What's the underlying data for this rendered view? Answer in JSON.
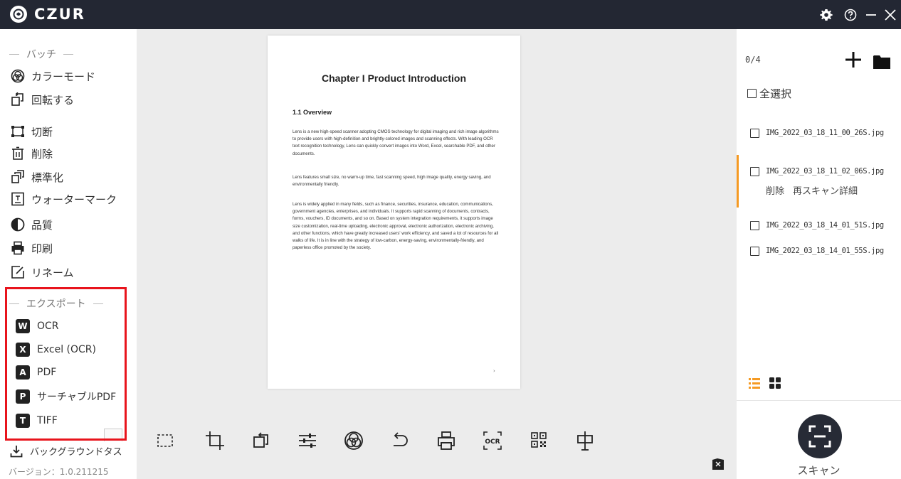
{
  "app": {
    "brand": "CZUR"
  },
  "sidebar": {
    "batch_header": "バッチ",
    "items": [
      {
        "label": "カラーモード",
        "icon": "color-mode-icon"
      },
      {
        "label": "回転する",
        "icon": "rotate-icon"
      },
      {
        "label": "切断",
        "icon": "crop-icon"
      },
      {
        "label": "削除",
        "icon": "trash-icon"
      },
      {
        "label": "標準化",
        "icon": "normalize-icon"
      },
      {
        "label": "ウォーターマーク",
        "icon": "watermark-icon"
      },
      {
        "label": "品質",
        "icon": "quality-icon"
      },
      {
        "label": "印刷",
        "icon": "print-icon"
      },
      {
        "label": "リネーム",
        "icon": "rename-icon"
      }
    ],
    "export_header": "エクスポート",
    "export_items": [
      {
        "label": "OCR",
        "badge": "W",
        "icon": "word-icon"
      },
      {
        "label": "Excel (OCR)",
        "badge": "X",
        "icon": "excel-icon"
      },
      {
        "label": "PDF",
        "badge": "A",
        "icon": "pdf-icon"
      },
      {
        "label": "サーチャブルPDF",
        "badge": "P",
        "icon": "searchable-pdf-icon"
      },
      {
        "label": "TIFF",
        "badge": "T",
        "icon": "tiff-icon"
      }
    ],
    "background_task": "バックグラウンドタス",
    "version": "バージョン：1.0.211215"
  },
  "document": {
    "title": "Chapter I Product Introduction",
    "section": "1.1 Overview",
    "paragraphs": [
      "Lens is a new high-speed scanner adopting CMOS technology for digital imaging and rich image algorithms to provide users with high-definition and brightly-colored images and scanning effects. With leading OCR text recognition technology, Lens can quickly convert images into Word, Excel, searchable PDF, and other documents.",
      "Lens features small size, no warm-up time, fast scanning speed, high image quality, energy saving, and environmentally friendly.",
      "Lens is widely applied in many fields, such as finance, securities, insurance, education, communications, government agencies, enterprises, and individuals. It supports rapid scanning of documents, contracts, forms, vouchers, ID documents, and so on. Based on system integration requirements, it supports image size customization, real-time uploading, electronic approval, electronic authorization, electronic archiving, and other functions, which have greatly increased users' work efficiency, and saved a lot of resources for all walks of life. It is in line with the strategy of low-carbon, energy-saving, environmentally-friendly, and paperless office promoted by the society."
    ],
    "page_number": "›"
  },
  "toolbar": {
    "tools": [
      "select-area-icon",
      "crop-icon",
      "rotate-icon",
      "adjust-icon",
      "color-mode-icon",
      "undo-icon",
      "print-icon",
      "ocr-icon",
      "qr-code-icon",
      "watermark-stamp-icon"
    ],
    "ocr_label": "OCR"
  },
  "files": {
    "count": "0/4",
    "select_all": "全選択",
    "items": [
      {
        "name": "IMG_2022_03_18_11_00_26S.jpg",
        "active": false
      },
      {
        "name": "IMG_2022_03_18_11_02_06S.jpg",
        "active": true
      },
      {
        "name": "IMG_2022_03_18_14_01_51S.jpg",
        "active": false
      },
      {
        "name": "IMG_2022_03_18_14_01_55S.jpg",
        "active": false
      }
    ],
    "actions": {
      "delete": "削除",
      "rescan": "再スキャン",
      "detail": "詳細"
    }
  },
  "scan": {
    "label": "スキャン"
  },
  "colors": {
    "titlebar": "#232733",
    "accent": "#f59a23",
    "highlight": "#e8141c",
    "scan_button": "#272b36"
  }
}
